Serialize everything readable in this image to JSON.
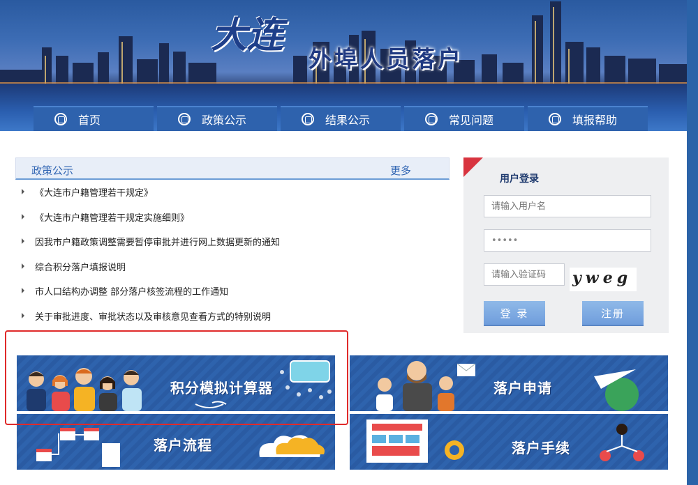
{
  "header": {
    "logo_city": "大连",
    "logo_title": "外埠人员落户"
  },
  "nav": {
    "items": [
      {
        "label": "首页",
        "icon": "home-icon"
      },
      {
        "label": "政策公示",
        "icon": "policy-icon"
      },
      {
        "label": "结果公示",
        "icon": "result-icon"
      },
      {
        "label": "常见问题",
        "icon": "faq-icon"
      },
      {
        "label": "填报帮助",
        "icon": "help-icon"
      }
    ]
  },
  "policy": {
    "title": "政策公示",
    "more": "更多",
    "items": [
      "《大连市户籍管理若干规定》",
      "《大连市户籍管理若干规定实施细则》",
      "因我市户籍政策调整需要暂停审批并进行网上数据更新的通知",
      "综合积分落户填报说明",
      "市人口结构办调整 部分落户核签流程的工作通知",
      "关于审批进度、审批状态以及审核意见查看方式的特别说明"
    ]
  },
  "login": {
    "title": "用户登录",
    "username_placeholder": "请输入用户名",
    "password_value": "•••••",
    "code_placeholder": "请输入验证码",
    "captcha": "yweg",
    "login_button": "登 录",
    "register_button": "注册"
  },
  "tiles": {
    "calculator": "积分模拟计算器",
    "apply": "落户申请",
    "process": "落户流程",
    "procedures": "落户手续"
  },
  "colors": {
    "brand_blue": "#2e62ad",
    "highlight_red": "#e02a2a"
  }
}
